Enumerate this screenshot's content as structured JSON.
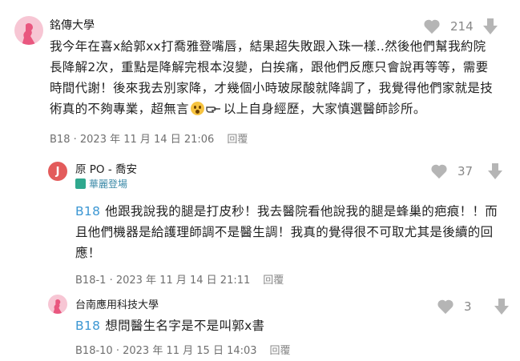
{
  "comments": [
    {
      "author": "銘傳大學",
      "likes": "214",
      "text_parts": [
        "我今年在喜x給郭xx打喬雅登嘴唇，結果超失敗跟入珠一樣..然後他們幫我約院長降解2次，重點是降解完根本沒變，白挨痛，跟他們反應只會說再等等，需要時間代謝！後來我去別家降，才幾個小時玻尿酸就降調了，我覺得他們家就是技術真的不夠專業，超無言",
        "以上自身經歷，大家慎選醫師診所。"
      ],
      "emoji": [
        "surprised-face-emoji",
        "pointing-hand-emoji"
      ],
      "floor": "B18",
      "timestamp": "2023 年 11 月 14 日 21:06",
      "reply_label": "回覆"
    },
    {
      "author": "原 PO - 喬安",
      "avatar_letter": "J",
      "badge": "華麗登場",
      "likes": "37",
      "ref": "B18",
      "text": "他跟我說我的腿是打皮秒！我去醫院看他說我的腿是蜂巢的疤痕！！而且他們機器是給護理師調不是醫生調！我真的覺得很不可取尤其是後續的回應！",
      "floor": "B18-1",
      "timestamp": "2023 年 11 月 14 日 21:11",
      "reply_label": "回覆"
    },
    {
      "author": "台南應用科技大學",
      "likes": "3",
      "ref": "B18",
      "text": "想問醫生名字是不是叫郭x書",
      "floor": "B18-10",
      "timestamp": "2023 年 11 月 15 日 14:03",
      "reply_label": "回覆"
    }
  ],
  "colors": {
    "accent": "#3c97d3",
    "avatar_pink": "#f7c6d4",
    "avatar_red": "#e35b5b",
    "badge": "#3c8aa8",
    "icon_gray": "#b5b5b5"
  }
}
